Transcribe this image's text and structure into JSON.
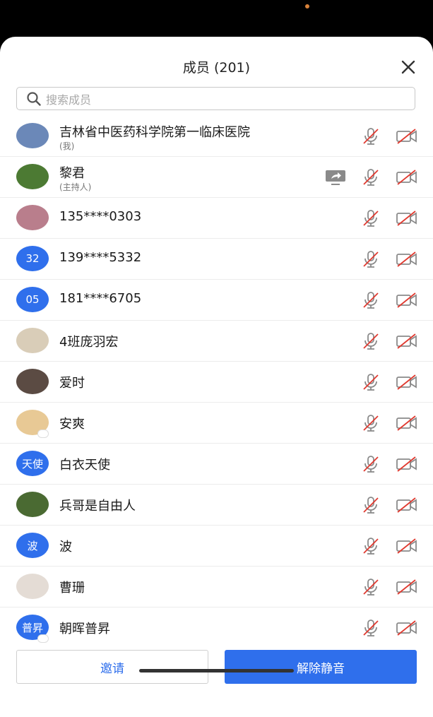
{
  "header": {
    "title": "成员 (201)"
  },
  "search": {
    "placeholder": "搜索成员"
  },
  "members": [
    {
      "name": "吉林省中医药科学院第一临床医院",
      "sub": "(我)",
      "avatar": {
        "type": "photo",
        "color": "#6b88b8"
      }
    },
    {
      "name": "黎君",
      "sub": "(主持人)",
      "avatar": {
        "type": "photo",
        "color": "#4c7a33"
      },
      "sharing": true
    },
    {
      "name": "135****0303",
      "avatar": {
        "type": "photo",
        "color": "#b97e8c"
      }
    },
    {
      "name": "139****5332",
      "avatar": {
        "type": "text",
        "text": "32"
      }
    },
    {
      "name": "181****6705",
      "avatar": {
        "type": "text",
        "text": "05"
      }
    },
    {
      "name": "4班庞羽宏",
      "avatar": {
        "type": "photo",
        "color": "#d9cdb8"
      }
    },
    {
      "name": "爱时",
      "avatar": {
        "type": "photo",
        "color": "#5b4b43"
      }
    },
    {
      "name": "安爽",
      "avatar": {
        "type": "photo",
        "color": "#e8c995"
      },
      "badge": true
    },
    {
      "name": "白衣天使",
      "avatar": {
        "type": "text",
        "text": "天使"
      }
    },
    {
      "name": "兵哥是自由人",
      "avatar": {
        "type": "photo",
        "color": "#4a6a32"
      }
    },
    {
      "name": "波",
      "avatar": {
        "type": "text",
        "text": "波"
      }
    },
    {
      "name": "曹珊",
      "avatar": {
        "type": "photo",
        "color": "#e4dcd5"
      }
    },
    {
      "name": "朝晖普昇",
      "avatar": {
        "type": "text",
        "text": "普昇"
      },
      "badge": true
    }
  ],
  "buttons": {
    "invite": "邀请",
    "unmute": "解除静音"
  },
  "colors": {
    "accent": "#2f6fec",
    "muted_red": "#e0392f"
  }
}
